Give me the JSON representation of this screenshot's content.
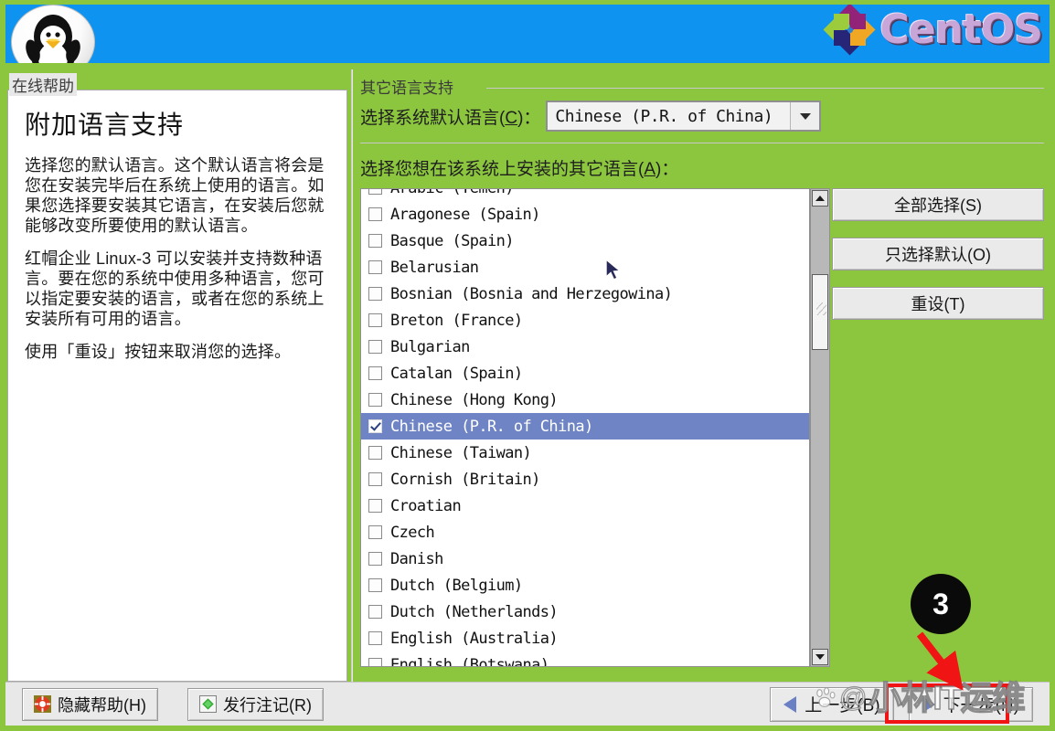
{
  "window": {
    "frame_color": "#8cc63f",
    "header_color": "#0e93f0",
    "brand": "CentOS",
    "penguin_icon": "tux-penguin-icon"
  },
  "help": {
    "tab_label": "在线帮助",
    "title": "附加语言支持",
    "paragraphs": [
      "选择您的默认语言。这个默认语言将会是您在安装完毕后在系统上使用的语言。如果您选择要安装其它语言，在安装后您就能够改变所要使用的默认语言。",
      "红帽企业 Linux-3 可以安装并支持数种语言。要在您的系统中使用多种语言，您可以指定要安装的语言，或者在您的系统上安装所有可用的语言。",
      "使用「重设」按钮来取消您的选择。"
    ]
  },
  "main": {
    "section_title": "其它语言支持",
    "default_lang_label": "选择系统默认语言",
    "default_lang_accel": "C",
    "default_lang_value": "Chinese (P.R. of China)",
    "install_list_label": "选择您想在该系统上安装的其它语言",
    "install_list_accel": "A",
    "languages": [
      {
        "label": "Arabic (Yemen)",
        "checked": false,
        "selected": false
      },
      {
        "label": "Aragonese (Spain)",
        "checked": false,
        "selected": false
      },
      {
        "label": "Basque (Spain)",
        "checked": false,
        "selected": false
      },
      {
        "label": "Belarusian",
        "checked": false,
        "selected": false
      },
      {
        "label": "Bosnian (Bosnia and Herzegowina)",
        "checked": false,
        "selected": false
      },
      {
        "label": "Breton (France)",
        "checked": false,
        "selected": false
      },
      {
        "label": "Bulgarian",
        "checked": false,
        "selected": false
      },
      {
        "label": "Catalan (Spain)",
        "checked": false,
        "selected": false
      },
      {
        "label": "Chinese (Hong Kong)",
        "checked": false,
        "selected": false
      },
      {
        "label": "Chinese (P.R. of China)",
        "checked": true,
        "selected": true
      },
      {
        "label": "Chinese (Taiwan)",
        "checked": false,
        "selected": false
      },
      {
        "label": "Cornish (Britain)",
        "checked": false,
        "selected": false
      },
      {
        "label": "Croatian",
        "checked": false,
        "selected": false
      },
      {
        "label": "Czech",
        "checked": false,
        "selected": false
      },
      {
        "label": "Danish",
        "checked": false,
        "selected": false
      },
      {
        "label": "Dutch (Belgium)",
        "checked": false,
        "selected": false
      },
      {
        "label": "Dutch (Netherlands)",
        "checked": false,
        "selected": false
      },
      {
        "label": "English (Australia)",
        "checked": false,
        "selected": false
      },
      {
        "label": "English (Botswana)",
        "checked": false,
        "selected": false
      }
    ],
    "side_buttons": [
      {
        "label": "全部选择(S)",
        "name": "select-all-button"
      },
      {
        "label": "只选择默认(O)",
        "name": "select-default-only-button"
      },
      {
        "label": "重设(T)",
        "name": "reset-button"
      }
    ],
    "selection_color": "#6f84c4"
  },
  "bottom": {
    "hide_help_label": "隐藏帮助(H)",
    "hide_help_icon": "lifebuoy-icon",
    "release_notes_label": "发行注记(R)",
    "release_notes_icon": "green-diamond-icon",
    "back_label": "上一步(B)",
    "next_label": "下一步(N)"
  },
  "annotation": {
    "step_number": "3",
    "arrow_color": "#f01414",
    "highlight_color": "#f01414"
  },
  "watermark": {
    "at": "@",
    "text": "小林IT运维",
    "logo": "baidu-paw-icon"
  }
}
